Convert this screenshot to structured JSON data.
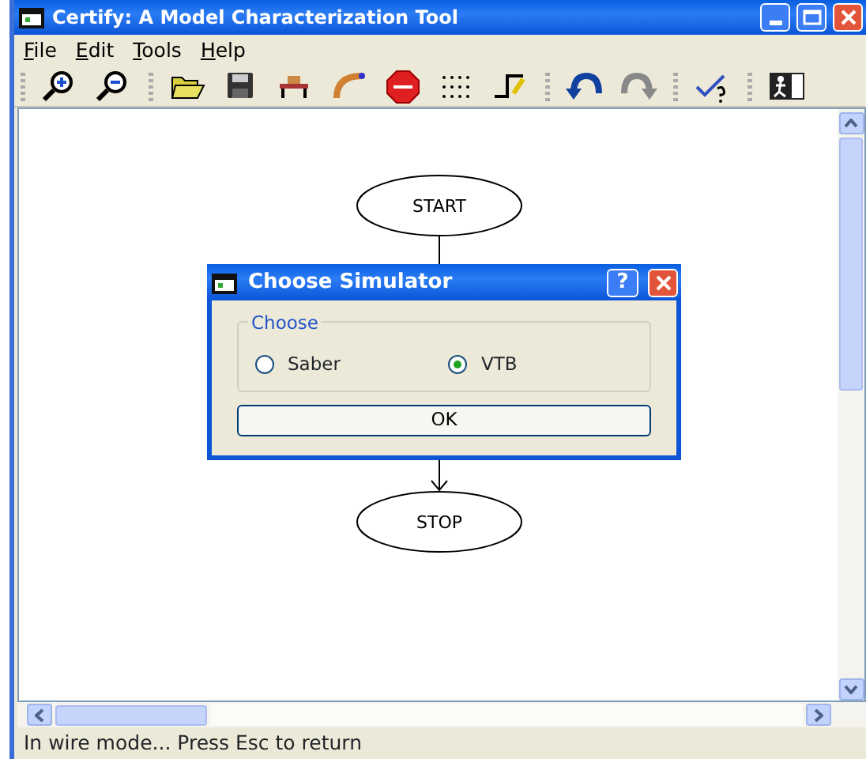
{
  "window": {
    "title": "Certify: A Model Characterization Tool"
  },
  "menu": [
    {
      "label": "File"
    },
    {
      "label": "Edit"
    },
    {
      "label": "Tools"
    },
    {
      "label": "Help"
    }
  ],
  "canvas": {
    "nodes": [
      {
        "label": "START"
      },
      {
        "label": "STOP"
      }
    ]
  },
  "dialog": {
    "title": "Choose Simulator",
    "help_button": "?",
    "group": {
      "label": "Choose",
      "options": [
        {
          "label": "Saber",
          "selected": false
        },
        {
          "label": "VTB",
          "selected": true
        }
      ]
    },
    "buttons": [
      "OK"
    ]
  },
  "status_bar": "In wire mode... Press Esc to return"
}
